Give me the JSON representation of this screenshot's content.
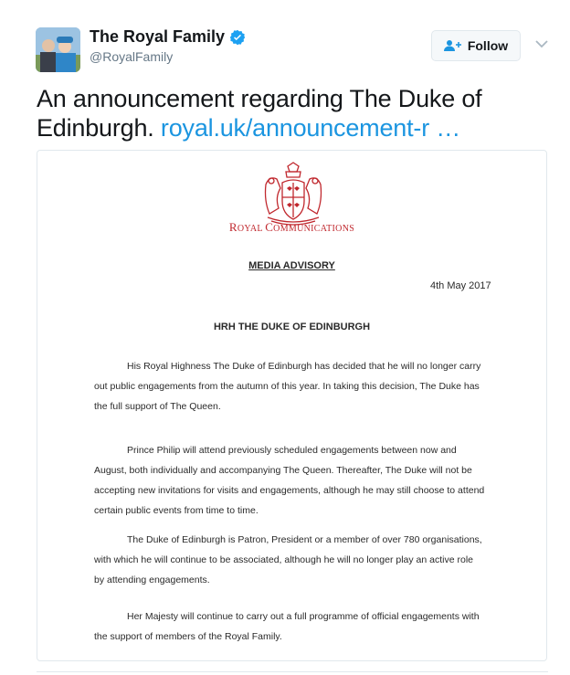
{
  "tweet": {
    "author_name": "The Royal Family",
    "handle": "@RoyalFamily",
    "follow_label": "Follow",
    "text": "An announcement regarding The Duke of Edinburgh.",
    "link": "royal.uk/announcement-r …"
  },
  "document": {
    "letterhead_first_letter": "R",
    "letterhead_rest": "OYAL ",
    "letterhead_c": "C",
    "letterhead_c_rest": "OMMUNICATIONS",
    "advisory": "MEDIA ADVISORY",
    "date": "4th May 2017",
    "title": "HRH THE DUKE OF EDINBURGH",
    "paragraphs": [
      [
        "His Royal Highness The Duke of Edinburgh has decided that he will no longer carry",
        "out public engagements from the autumn of this year. In taking this decision, The Duke has",
        "the full support of The Queen."
      ],
      [
        "Prince Philip will attend previously scheduled engagements between now and",
        "August, both individually and accompanying The Queen. Thereafter, The Duke will not be",
        "accepting new invitations for visits and engagements, although he may still choose to attend",
        "certain public events from time to time."
      ],
      [
        "The Duke of Edinburgh is Patron, President or a member of over 780 organisations,",
        "with which he will continue to be associated, although he will no longer play an active role",
        "by attending engagements."
      ],
      [
        "Her Majesty will continue to carry out a full programme of official engagements with",
        "the support of members of the Royal Family."
      ]
    ]
  },
  "colors": {
    "link": "#1b95e0",
    "verified": "#1da1f2",
    "crest": "#c0272d"
  }
}
